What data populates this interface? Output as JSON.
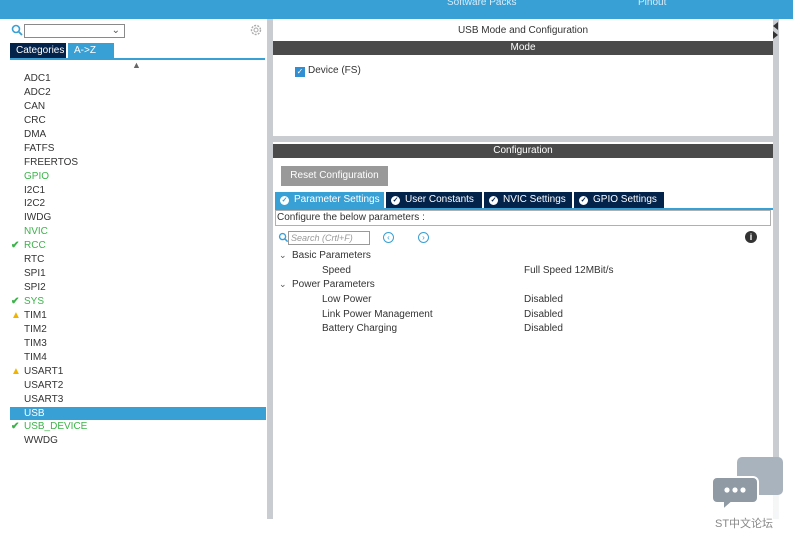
{
  "topbar": {
    "left_text": "Software Packs",
    "right_text": "Pinout"
  },
  "left_panel": {
    "search": {
      "value": "",
      "dropdown_icon": "chevron-down-icon"
    },
    "tabs": [
      {
        "label": "Categories"
      },
      {
        "label": "A->Z"
      }
    ],
    "peripherals": [
      {
        "label": "ADC1",
        "status": "none"
      },
      {
        "label": "ADC2",
        "status": "none"
      },
      {
        "label": "CAN",
        "status": "none"
      },
      {
        "label": "CRC",
        "status": "none"
      },
      {
        "label": "DMA",
        "status": "none"
      },
      {
        "label": "FATFS",
        "status": "none"
      },
      {
        "label": "FREERTOS",
        "status": "none"
      },
      {
        "label": "GPIO",
        "status": "configured-green"
      },
      {
        "label": "I2C1",
        "status": "none"
      },
      {
        "label": "I2C2",
        "status": "none"
      },
      {
        "label": "IWDG",
        "status": "none"
      },
      {
        "label": "NVIC",
        "status": "configured-green"
      },
      {
        "label": "RCC",
        "status": "check"
      },
      {
        "label": "RTC",
        "status": "none"
      },
      {
        "label": "SPI1",
        "status": "none"
      },
      {
        "label": "SPI2",
        "status": "none"
      },
      {
        "label": "SYS",
        "status": "check"
      },
      {
        "label": "TIM1",
        "status": "warning"
      },
      {
        "label": "TIM2",
        "status": "none"
      },
      {
        "label": "TIM3",
        "status": "none"
      },
      {
        "label": "TIM4",
        "status": "none"
      },
      {
        "label": "USART1",
        "status": "warning"
      },
      {
        "label": "USART2",
        "status": "none"
      },
      {
        "label": "USART3",
        "status": "none"
      },
      {
        "label": "USB",
        "status": "selected"
      },
      {
        "label": "USB_DEVICE",
        "status": "check"
      },
      {
        "label": "WWDG",
        "status": "none"
      }
    ]
  },
  "right_panel": {
    "title": "USB Mode and Configuration",
    "mode_header": "Mode",
    "mode_checkbox": {
      "label": "Device (FS)",
      "checked": true
    },
    "config_header": "Configuration",
    "reset_button": "Reset Configuration",
    "tabs": [
      {
        "label": "Parameter Settings",
        "active": true
      },
      {
        "label": "User Constants",
        "active": false
      },
      {
        "label": "NVIC Settings",
        "active": false
      },
      {
        "label": "GPIO Settings",
        "active": false
      }
    ],
    "config_description": "Configure the below parameters :",
    "search_placeholder": "Search (Crtl+F)",
    "groups": [
      {
        "label": "Basic Parameters",
        "params": [
          {
            "name": "Speed",
            "value": "Full Speed 12MBit/s"
          }
        ]
      },
      {
        "label": "Power Parameters",
        "params": [
          {
            "name": "Low Power",
            "value": "Disabled"
          },
          {
            "name": "Link Power Management",
            "value": "Disabled"
          },
          {
            "name": "Battery Charging",
            "value": "Disabled"
          }
        ]
      }
    ]
  },
  "watermark": {
    "text": "ST中文论坛"
  },
  "colors": {
    "accent": "#39a0d6",
    "dark_tab": "#03234b",
    "section_bar": "#4a4a4a",
    "green": "#3cb34a",
    "warning": "#f0b400"
  }
}
